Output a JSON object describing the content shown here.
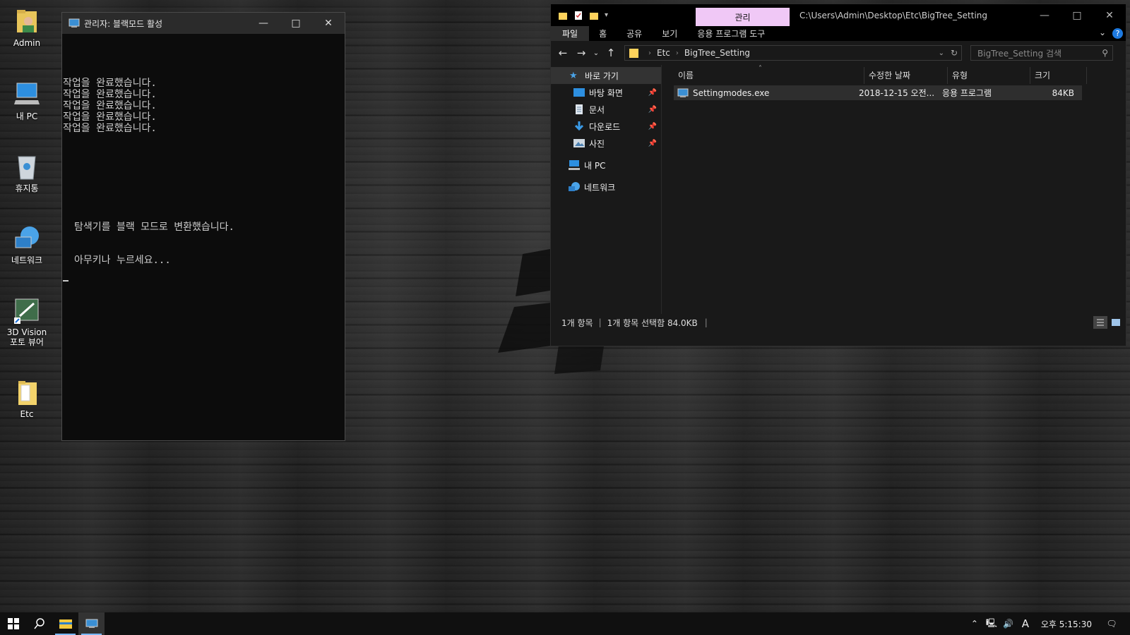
{
  "desktop": {
    "icons": [
      {
        "label": "Admin",
        "icon": "user-folder-icon"
      },
      {
        "label": "내 PC",
        "icon": "computer-icon"
      },
      {
        "label": "휴지통",
        "icon": "recycle-bin-icon"
      },
      {
        "label": "네트워크",
        "icon": "network-icon"
      },
      {
        "label_line1": "3D Vision",
        "label_line2": "포토 뷰어",
        "icon": "3d-vision-icon"
      },
      {
        "label": "Etc",
        "icon": "folder-icon"
      }
    ]
  },
  "console": {
    "title": "관리자:  블랙모드 활성",
    "lines": [
      "작업을 완료했습니다.",
      "작업을 완료했습니다.",
      "작업을 완료했습니다.",
      "작업을 완료했습니다.",
      "작업을 완료했습니다."
    ],
    "message1": "탐색기를 블랙 모드로 변환했습니다.",
    "message2": "아무키나 누르세요..."
  },
  "explorer": {
    "manage_tab": "관리",
    "title_path": "C:\\Users\\Admin\\Desktop\\Etc\\BigTree_Setting",
    "ribbon_tabs": [
      "파일",
      "홈",
      "공유",
      "보기",
      "응용 프로그램 도구"
    ],
    "address": {
      "crumbs": [
        "Etc",
        "BigTree_Setting"
      ]
    },
    "search_placeholder": "BigTree_Setting 검색",
    "nav_pane": {
      "quick_access": "바로 가기",
      "pinned": [
        "바탕 화면",
        "문서",
        "다운로드",
        "사진"
      ],
      "this_pc": "내 PC",
      "network": "네트워크"
    },
    "columns": [
      "이름",
      "수정한 날짜",
      "유형",
      "크기"
    ],
    "files": [
      {
        "name": "Settingmodes.exe",
        "modified": "2018-12-15 오전...",
        "type": "응용 프로그램",
        "size": "84KB"
      }
    ],
    "status": {
      "count": "1개 항목",
      "selected": "1개 항목 선택함 84.0KB"
    }
  },
  "taskbar": {
    "clock": "오후 5:15:30",
    "ime": "A",
    "colors": {
      "accent": "#79b8ff",
      "manage_tab": "#f0c8f6"
    }
  }
}
